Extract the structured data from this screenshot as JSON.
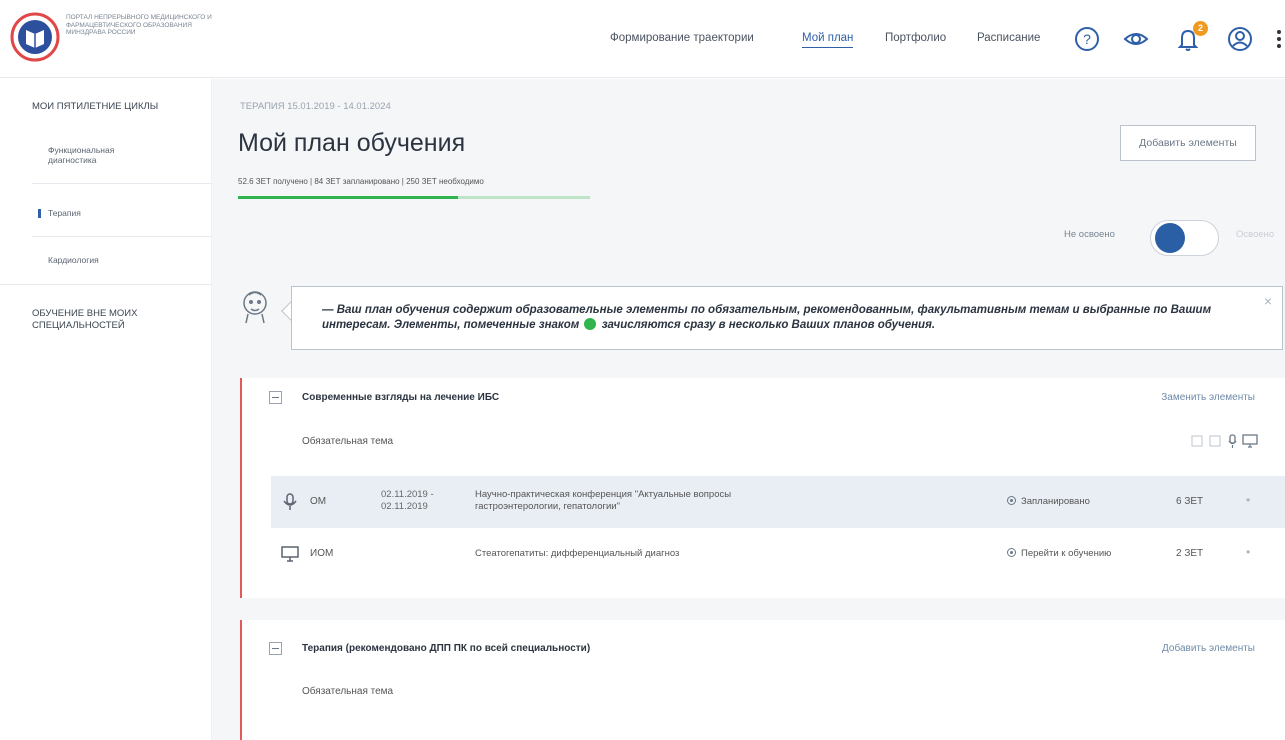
{
  "header": {
    "logo_text": "Портал непрерывного медицинского и фармацевтического образования Минздрава России",
    "nav": [
      {
        "label": "Формирование траектории"
      },
      {
        "label": "Мой план"
      },
      {
        "label": "Портфолио"
      },
      {
        "label": "Расписание"
      }
    ],
    "notifications_count": "2",
    "icons": [
      "help-icon",
      "eye-icon",
      "bell-icon",
      "user-icon",
      "more-icon"
    ]
  },
  "sidebar": {
    "section1": "Мои пятилетние циклы",
    "items": [
      {
        "label": "Функциональная диагностика"
      },
      {
        "label": "Терапия"
      },
      {
        "label": "Кардиология"
      }
    ],
    "section2": "Обучение вне моих специальностей"
  },
  "main": {
    "breadcrumb": "ТЕРАПИЯ 15.01.2019 - 14.01.2024",
    "title": "Мой план обучения",
    "add_button": "Добавить элементы",
    "stats": "52.6 ЗЕТ получено  |  84 ЗЕТ запланировано  |  250 ЗЕТ необходимо",
    "progress_obtained": 52.6,
    "progress_planned": 84,
    "progress_required": 250,
    "toggle_left": "Не освоено",
    "toggle_right": "Освоено",
    "info_text_1": "— Ваш план обучения содержит образовательные элементы по обязательным, рекомендованным, факультативным темам и выбранные по Вашим интересам. Элементы, помеченные знаком",
    "info_text_2": "зачисляются сразу в несколько Ваших планов обучения.",
    "close": "×"
  },
  "cards": [
    {
      "title": "Современные взгляды на лечение ИБС",
      "action": "Заменить элементы",
      "subtopic": "Обязательная тема",
      "rows": [
        {
          "type": "ОМ",
          "icon": "mic-icon",
          "dates": "02.11.2019 -\n02.11.2019",
          "date1": "02.11.2019 -",
          "date2": "02.11.2019",
          "name1": "Научно-практическая конференция \"Актуальные вопросы",
          "name2": "гастроэнтерологии, гепатологии\"",
          "status": "Запланировано",
          "zet": "6 ЗЕТ"
        },
        {
          "type": "ИОМ",
          "icon": "monitor-icon",
          "date1": "",
          "date2": "",
          "name1": "Стеатогепатиты: дифференциальный диагноз",
          "name2": "",
          "status": "Перейти к обучению",
          "zet": "2 ЗЕТ"
        }
      ]
    },
    {
      "title": "Терапия (рекомендовано ДПП ПК по всей специальности)",
      "action": "Добавить элементы",
      "subtopic": "Обязательная тема"
    }
  ],
  "colors": {
    "accent": "#2e5fa8",
    "progress": "#2fb44e",
    "card_border": "#e05a5a",
    "badge": "#f29a1f"
  }
}
